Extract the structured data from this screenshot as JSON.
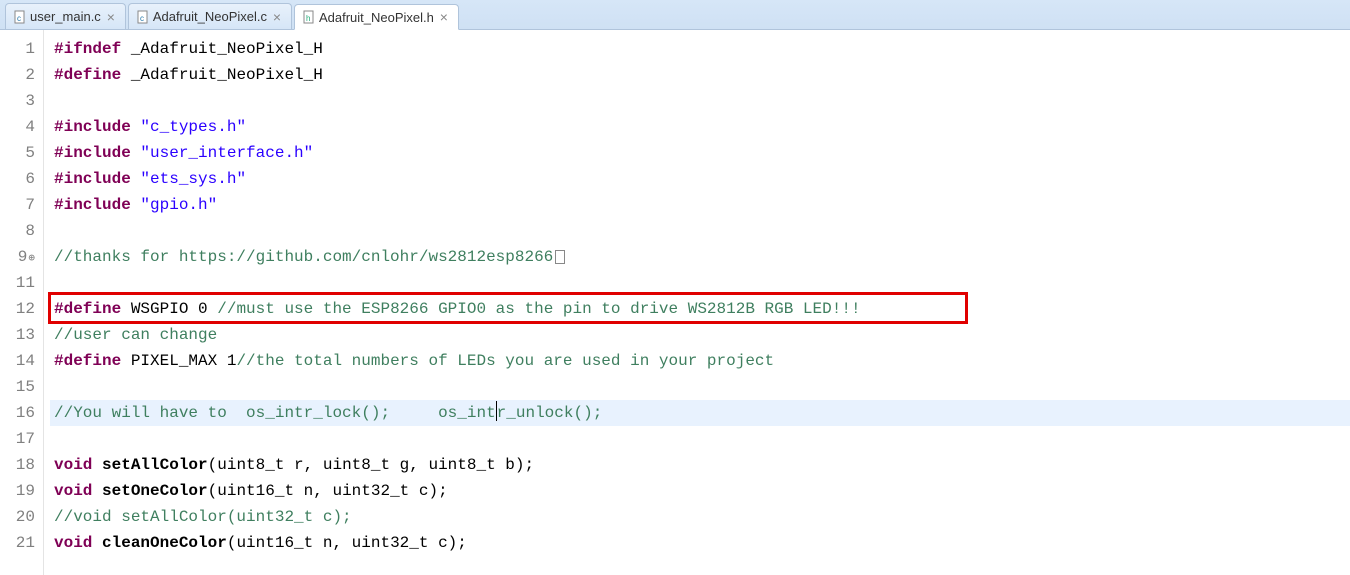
{
  "tabs": [
    {
      "label": "user_main.c",
      "active": false,
      "icon_letter": "c"
    },
    {
      "label": "Adafruit_NeoPixel.c",
      "active": false,
      "icon_letter": "c"
    },
    {
      "label": "Adafruit_NeoPixel.h",
      "active": true,
      "icon_letter": "h"
    }
  ],
  "code": {
    "lines": [
      {
        "n": 1,
        "tokens": [
          {
            "t": "#ifndef",
            "c": "kw"
          },
          {
            "t": " ",
            "c": "id"
          },
          {
            "t": "_Adafruit_NeoPixel_H",
            "c": "id"
          }
        ]
      },
      {
        "n": 2,
        "tokens": [
          {
            "t": "#define",
            "c": "kw"
          },
          {
            "t": " ",
            "c": "id"
          },
          {
            "t": "_Adafruit_NeoPixel_H",
            "c": "id"
          }
        ]
      },
      {
        "n": 3,
        "tokens": []
      },
      {
        "n": 4,
        "tokens": [
          {
            "t": "#include",
            "c": "kw"
          },
          {
            "t": " ",
            "c": "id"
          },
          {
            "t": "\"c_types.h\"",
            "c": "str"
          }
        ]
      },
      {
        "n": 5,
        "tokens": [
          {
            "t": "#include",
            "c": "kw"
          },
          {
            "t": " ",
            "c": "id"
          },
          {
            "t": "\"user_interface.h\"",
            "c": "str"
          }
        ]
      },
      {
        "n": 6,
        "tokens": [
          {
            "t": "#include",
            "c": "kw"
          },
          {
            "t": " ",
            "c": "id"
          },
          {
            "t": "\"ets_sys.h\"",
            "c": "str"
          }
        ]
      },
      {
        "n": 7,
        "tokens": [
          {
            "t": "#include",
            "c": "kw"
          },
          {
            "t": " ",
            "c": "id"
          },
          {
            "t": "\"gpio.h\"",
            "c": "str"
          }
        ]
      },
      {
        "n": 8,
        "tokens": []
      },
      {
        "n": 9,
        "folded": true,
        "tokens": [
          {
            "t": "//thanks for https://github.com/cnlohr/ws2812esp8266",
            "c": "cmt"
          }
        ]
      },
      {
        "n": 11,
        "tokens": []
      },
      {
        "n": 12,
        "boxed": true,
        "tokens": [
          {
            "t": "#define",
            "c": "kw"
          },
          {
            "t": " WSGPIO 0 ",
            "c": "id"
          },
          {
            "t": "//must use the ESP8266 GPIO0 as the pin to drive WS2812B RGB LED!!!",
            "c": "cmt"
          }
        ]
      },
      {
        "n": 13,
        "tokens": [
          {
            "t": "//user can change",
            "c": "cmt"
          }
        ]
      },
      {
        "n": 14,
        "tokens": [
          {
            "t": "#define",
            "c": "kw"
          },
          {
            "t": " PIXEL_MAX 1",
            "c": "id"
          },
          {
            "t": "//the total numbers of LEDs you are used in your project",
            "c": "cmt"
          }
        ]
      },
      {
        "n": 15,
        "tokens": []
      },
      {
        "n": 16,
        "current": true,
        "caret_after": 5,
        "tokens": [
          {
            "t": "//You will have to  os_intr_lock();     os_int",
            "c": "cmt"
          },
          {
            "t": "r_unlock();",
            "c": "cmt"
          }
        ]
      },
      {
        "n": 17,
        "tokens": []
      },
      {
        "n": 18,
        "tokens": [
          {
            "t": "void",
            "c": "kw"
          },
          {
            "t": " ",
            "c": "id"
          },
          {
            "t": "setAllColor",
            "c": "fn"
          },
          {
            "t": "(uint8_t r, uint8_t g, uint8_t b);",
            "c": "id"
          }
        ]
      },
      {
        "n": 19,
        "tokens": [
          {
            "t": "void",
            "c": "kw"
          },
          {
            "t": " ",
            "c": "id"
          },
          {
            "t": "setOneColor",
            "c": "fn"
          },
          {
            "t": "(uint16_t n, uint32_t c);",
            "c": "id"
          }
        ]
      },
      {
        "n": 20,
        "tokens": [
          {
            "t": "//void setAllColor(uint32_t c);",
            "c": "cmt"
          }
        ]
      },
      {
        "n": 21,
        "tokens": [
          {
            "t": "void",
            "c": "kw"
          },
          {
            "t": " ",
            "c": "id"
          },
          {
            "t": "cleanOneColor",
            "c": "fn"
          },
          {
            "t": "(uint16_t n, uint32_t c);",
            "c": "id"
          }
        ]
      }
    ]
  },
  "highlight_box": {
    "line": 12
  }
}
